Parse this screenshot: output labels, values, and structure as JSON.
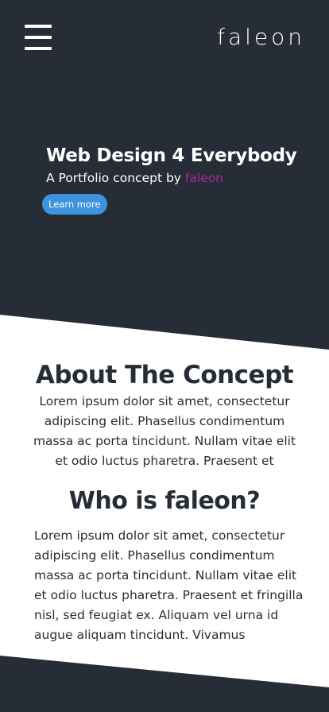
{
  "header": {
    "menu_icon": "hamburger-menu-icon",
    "brand": "faleon"
  },
  "hero": {
    "title": "Web Design 4 Everybody",
    "subtitle_prefix": "A Portfolio concept by ",
    "subtitle_accent": "faleon",
    "button_label": "Learn more"
  },
  "about": {
    "title": "About The Concept",
    "text": "Lorem ipsum dolor sit amet, consectetur adipiscing elit. Phasellus condimentum massa ac porta tincidunt. Nullam vitae elit et odio luctus pharetra. Praesent et"
  },
  "who": {
    "title": "Who is faleon?",
    "text": "Lorem ipsum dolor sit amet, consectetur adipiscing elit. Phasellus condimentum massa ac porta tincidunt. Nullam vitae elit et odio luctus pharetra. Praesent et fringilla nisl, sed feugiat ex. Aliquam vel urna id augue aliquam tincidunt. Vivamus"
  },
  "colors": {
    "dark": "#262d37",
    "accent": "#a8289a",
    "button": "#3d93dd",
    "background": "#ffffff"
  }
}
